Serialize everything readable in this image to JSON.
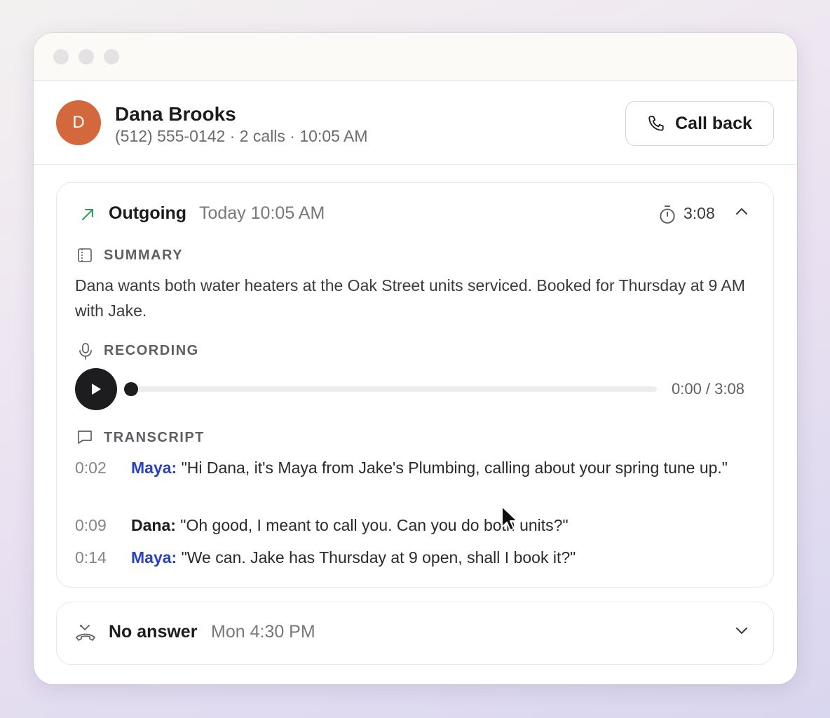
{
  "contact": {
    "initial": "D",
    "name": "Dana Brooks",
    "meta": "(512) 555-0142 · 2 calls · 10:05 AM",
    "avatar_color": "#d4683d"
  },
  "call_back_button": {
    "label": "Call back",
    "icon": "phone-icon"
  },
  "calls": [
    {
      "direction": "Outgoing",
      "time": "Today 10:05 AM",
      "duration": "3:08",
      "expanded": true,
      "direction_icon": "arrow-up-right-icon",
      "direction_color": "#2f9a5b",
      "summary": {
        "label": "SUMMARY",
        "text": "Dana wants both water heaters at the Oak Street units serviced. Booked for Thursday at 9 AM with Jake."
      },
      "recording": {
        "label": "RECORDING",
        "progress": 0,
        "time_display": "0:00 / 3:08"
      },
      "transcript": {
        "label": "TRANSCRIPT",
        "lines": [
          {
            "ts": "0:02",
            "speaker": "Maya:",
            "text": "\"Hi Dana, it's Maya from Jake's Plumbing, calling about your spring tune up.\""
          },
          {
            "ts": "0:09",
            "speaker": "Dana:",
            "text": "\"Oh good, I meant to call you. Can you do both units?\""
          },
          {
            "ts": "0:14",
            "speaker": "Maya:",
            "text": "\"We can. Jake has Thursday at 9 open, shall I book it?\""
          }
        ]
      }
    },
    {
      "direction": "No answer",
      "time": "Mon 4:30 PM",
      "expanded": false,
      "direction_icon": "missed-call-icon"
    }
  ],
  "colors": {
    "accent_speaker": "#2a44b8",
    "dark": "#1d1d20"
  }
}
